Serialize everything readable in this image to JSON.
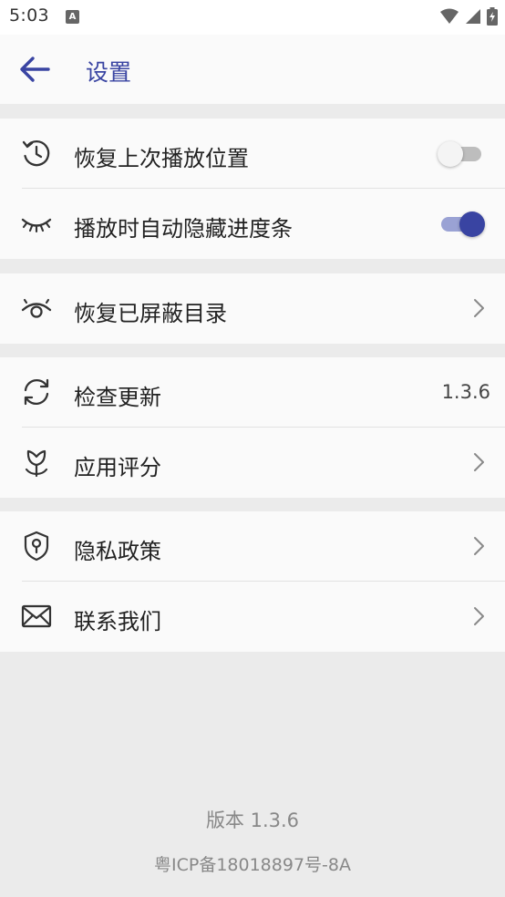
{
  "status_bar": {
    "time": "5:03",
    "notification_icon": "a-icon",
    "right_icons": [
      "wifi-icon",
      "signal-icon",
      "battery-charging-icon"
    ]
  },
  "header": {
    "back_icon": "arrow-left-icon",
    "title": "设置",
    "accent_color": "#3944a2"
  },
  "groups": [
    {
      "items": [
        {
          "icon": "history-icon",
          "label": "恢复上次播放位置",
          "control": "toggle",
          "toggle_on": false
        },
        {
          "icon": "eye-closed-icon",
          "label": "播放时自动隐藏进度条",
          "control": "toggle",
          "toggle_on": true
        }
      ]
    },
    {
      "items": [
        {
          "icon": "eye-icon",
          "label": "恢复已屏蔽目录",
          "control": "chevron"
        }
      ]
    },
    {
      "items": [
        {
          "icon": "refresh-icon",
          "label": "检查更新",
          "control": "value",
          "value": "1.3.6"
        },
        {
          "icon": "flower-icon",
          "label": "应用评分",
          "control": "chevron"
        }
      ]
    },
    {
      "items": [
        {
          "icon": "shield-icon",
          "label": "隐私政策",
          "control": "chevron"
        },
        {
          "icon": "mail-icon",
          "label": "联系我们",
          "control": "chevron"
        }
      ]
    }
  ],
  "footer": {
    "version": "版本 1.3.6",
    "icp": "粤ICP备18018897号-8A"
  }
}
